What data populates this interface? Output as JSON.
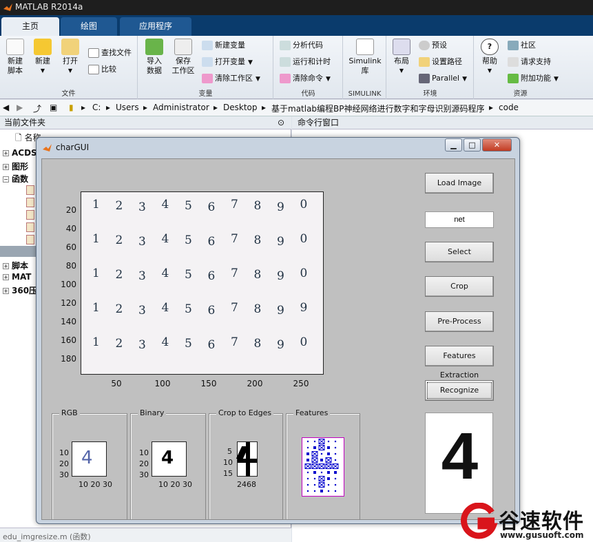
{
  "app": {
    "title": "MATLAB R2014a"
  },
  "tabs": [
    {
      "label": "主页"
    },
    {
      "label": "绘图"
    },
    {
      "label": "应用程序"
    }
  ],
  "ribbon": {
    "file": {
      "caption": "文件",
      "new_script": "新建\n脚本",
      "new": "新建",
      "open": "打开",
      "find_files": "查找文件",
      "compare": "比较"
    },
    "variable": {
      "caption": "变量",
      "import": "导入\n数据",
      "save_ws": "保存\n工作区",
      "new_var": "新建变量",
      "open_var": "打开变量",
      "clear_ws": "清除工作区"
    },
    "code": {
      "caption": "代码",
      "analyze": "分析代码",
      "run_time": "运行和计时",
      "clear_cmd": "清除命令"
    },
    "simulink": {
      "caption": "SIMULINK",
      "lib": "Simulink\n库"
    },
    "env": {
      "caption": "环境",
      "layout": "布局",
      "prefs": "预设",
      "set_path": "设置路径",
      "parallel": "Parallel"
    },
    "resources": {
      "caption": "资源",
      "help": "帮助",
      "community": "社区",
      "support": "请求支持",
      "addons": "附加功能"
    }
  },
  "address": {
    "parts": [
      "C:",
      "Users",
      "Administrator",
      "Desktop",
      "基于matlab编程BP神经网络进行数字和字母识别源码程序",
      "code"
    ]
  },
  "file_panel": {
    "header": "当前文件夹",
    "name_col": "名称",
    "tree": [
      {
        "label": "ACDS"
      },
      {
        "label": "图形"
      },
      {
        "label": "函数"
      },
      {
        "label": "脚本"
      },
      {
        "label": "MAT"
      },
      {
        "label": "360压"
      }
    ],
    "status": "edu_imgresize.m (函数)"
  },
  "cmd_panel": {
    "header": "命令行窗口"
  },
  "gui": {
    "title": "charGUI",
    "buttons": {
      "load": "Load Image",
      "select": "Select",
      "crop": "Crop",
      "preprocess": "Pre-Process",
      "features": "Features Extraction",
      "recognize": "Recognize"
    },
    "net_field": "net",
    "axes": {
      "yticks": [
        "20",
        "40",
        "60",
        "80",
        "100",
        "120",
        "140",
        "160",
        "180"
      ],
      "xticks": [
        "50",
        "100",
        "150",
        "200",
        "250"
      ],
      "digits_rows": [
        [
          "1",
          "2",
          "3",
          "4",
          "5",
          "6",
          "7",
          "8",
          "9",
          "0"
        ],
        [
          "1",
          "2",
          "3",
          "4",
          "5",
          "6",
          "7",
          "8",
          "9",
          "0"
        ],
        [
          "1",
          "2",
          "3",
          "4",
          "5",
          "6",
          "7",
          "8",
          "9",
          "0"
        ],
        [
          "1",
          "2",
          "3",
          "4",
          "5",
          "6",
          "7",
          "8",
          "9",
          "9"
        ],
        [
          "1",
          "2",
          "3",
          "4",
          "5",
          "6",
          "7",
          "8",
          "9",
          "0"
        ]
      ]
    },
    "panels": {
      "rgb": {
        "title": "RGB",
        "yticks": [
          "10",
          "20",
          "30"
        ],
        "xticks": "10 20 30"
      },
      "binary": {
        "title": "Binary",
        "yticks": [
          "10",
          "20",
          "30"
        ],
        "xticks": "10 20 30"
      },
      "crop": {
        "title": "Crop to Edges",
        "yticks": [
          "5",
          "10",
          "15"
        ],
        "xticks": "2468"
      },
      "features": {
        "title": "Features"
      }
    },
    "result": "4"
  },
  "watermark": {
    "brand": "谷速软件",
    "url": "www.gusuoft.com"
  },
  "colors": {
    "tab_bar": "#0a3b6c",
    "gui_bg": "#c0c0c0",
    "feature_border": "#c000c0",
    "feature_mark": "#0000cc",
    "watermark_red": "#d9151b"
  }
}
